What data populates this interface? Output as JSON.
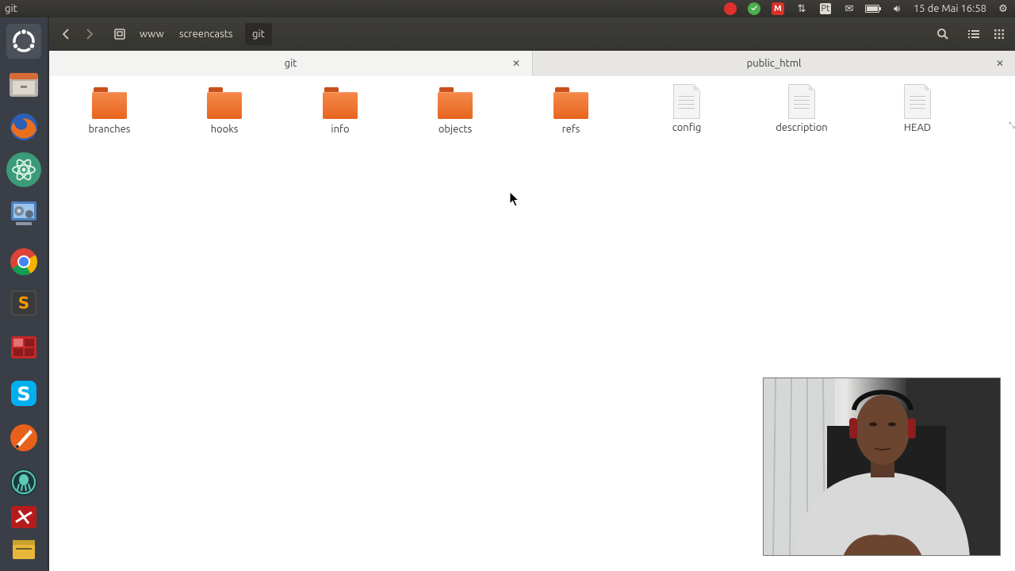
{
  "window": {
    "title": "git"
  },
  "panel": {
    "clock": "15 de Mai 16:58",
    "indicators": [
      "record-icon",
      "check-icon",
      "gmail-icon",
      "network-updown-icon",
      "keyboard-layout-icon",
      "mail-icon",
      "battery-icon",
      "volume-icon",
      "settings-gear-icon"
    ],
    "keyboard_layout": "Pt",
    "gmail_letter": "M"
  },
  "launcher": {
    "items": [
      "ubuntu-dash-icon",
      "files-icon",
      "firefox-icon",
      "atom-icon",
      "system-settings-icon",
      "chrome-icon",
      "sublime-text-icon",
      "workspace-switcher-icon",
      "skype-icon",
      "inkscape-icon",
      "gitkraken-icon",
      "filezilla-icon",
      "trash-icon"
    ]
  },
  "breadcrumb": {
    "items": [
      "www",
      "screencasts",
      "git"
    ],
    "active_index": 2
  },
  "tabs": [
    {
      "label": "git",
      "active": true
    },
    {
      "label": "public_html",
      "active": false
    }
  ],
  "files": [
    {
      "name": "branches",
      "type": "folder"
    },
    {
      "name": "hooks",
      "type": "folder"
    },
    {
      "name": "info",
      "type": "folder"
    },
    {
      "name": "objects",
      "type": "folder"
    },
    {
      "name": "refs",
      "type": "folder"
    },
    {
      "name": "config",
      "type": "file"
    },
    {
      "name": "description",
      "type": "file"
    },
    {
      "name": "HEAD",
      "type": "file"
    }
  ],
  "colors": {
    "folder": "#ed7032",
    "panel_bg": "#3c3b37",
    "launcher_bg": "#3a3f47"
  }
}
